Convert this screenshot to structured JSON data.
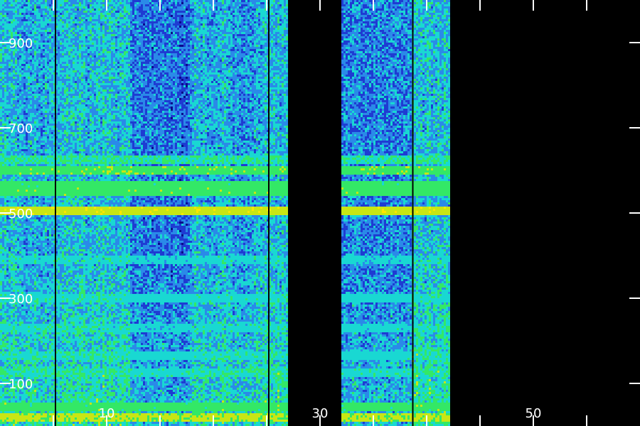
{
  "chart_data": {
    "type": "heatmap",
    "title": "",
    "xlabel": "",
    "ylabel": "",
    "xlim": [
      0,
      60
    ],
    "ylim": [
      0,
      1000
    ],
    "x_ticks": [
      5,
      10,
      15,
      20,
      25,
      30,
      35,
      40,
      45,
      50,
      55
    ],
    "x_tick_labels": [
      {
        "value": 10,
        "label": "10"
      },
      {
        "value": 30,
        "label": "30"
      },
      {
        "value": 50,
        "label": "50"
      }
    ],
    "y_ticks": [
      100,
      300,
      500,
      700,
      900
    ],
    "y_tick_labels": [
      {
        "value": 100,
        "label": "100"
      },
      {
        "value": 300,
        "label": "300"
      },
      {
        "value": 500,
        "label": "500"
      },
      {
        "value": 700,
        "label": "700"
      },
      {
        "value": 900,
        "label": "900"
      }
    ],
    "grid": false,
    "colormap": [
      "#000000",
      "#0a0a8c",
      "#1e3cd2",
      "#2a8ae8",
      "#19d8d2",
      "#33e866",
      "#c8e614",
      "#ffe600",
      "#ff8800"
    ],
    "no_data_color": "#000000",
    "data_x_ranges": [
      [
        0,
        27
      ],
      [
        32,
        42.3
      ]
    ],
    "column_intensity": [
      {
        "x": [
          0,
          5.2
        ],
        "level": 0.44
      },
      {
        "x": [
          5.2,
          12.2
        ],
        "level": 0.46
      },
      {
        "x": [
          12.2,
          17.8
        ],
        "level": 0.34
      },
      {
        "x": [
          17.8,
          21.8
        ],
        "level": 0.44
      },
      {
        "x": [
          21.8,
          23.8
        ],
        "level": 0.39
      },
      {
        "x": [
          23.8,
          27
        ],
        "level": 0.46
      },
      {
        "x": [
          32,
          38.7
        ],
        "level": 0.37
      },
      {
        "x": [
          38.7,
          42.3
        ],
        "level": 0.47
      }
    ],
    "dark_vertical_lines_x": [
      5.2,
      25.2,
      38.7
    ],
    "horizontal_features": [
      {
        "y": 20,
        "level": 0.72,
        "note_level": "band"
      },
      {
        "y": 45,
        "level": 0.62
      },
      {
        "y": 125,
        "level": 0.52
      },
      {
        "y": 165,
        "level": 0.5
      },
      {
        "y": 230,
        "level": 0.48
      },
      {
        "y": 300,
        "level": 0.5
      },
      {
        "y": 390,
        "level": 0.48
      },
      {
        "y": 505,
        "level": 0.76
      },
      {
        "y": 550,
        "level": 0.63
      },
      {
        "y": 568,
        "level": 0.62
      },
      {
        "y": 600,
        "level": 0.64
      },
      {
        "y": 625,
        "level": 0.56
      }
    ],
    "low_rows_boost": [
      {
        "y": [
          0,
          400
        ],
        "amount": 0.1
      }
    ]
  }
}
